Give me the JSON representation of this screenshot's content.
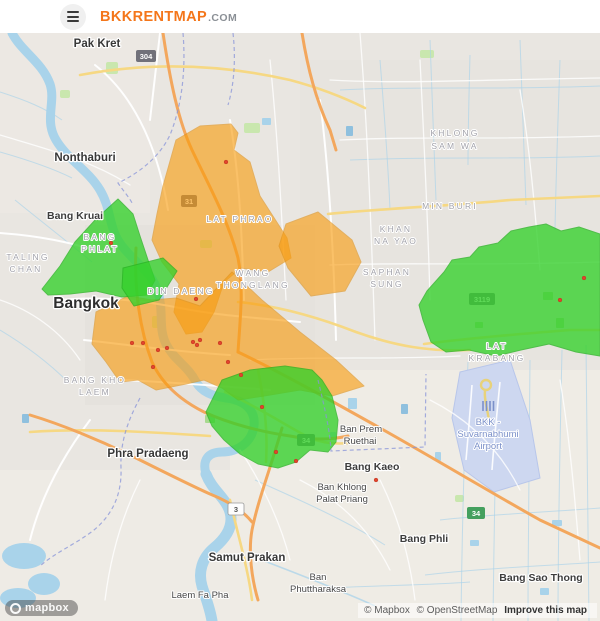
{
  "header": {
    "brand": "BKKRENTMAP",
    "brand_suffix": ".COM"
  },
  "colors": {
    "brand_orange": "#F4761A",
    "land": "#E9E6E1",
    "water": "#A9D3EA",
    "zone_orange": "#F99C0E",
    "zone_green": "#34D12B",
    "road_yellow": "#F6D883",
    "road_orange": "#F3A75D",
    "airport_fill": "#CDD7F0",
    "marker_red": "#E2442C"
  },
  "map": {
    "places": {
      "pak_kret": "Pak Kret",
      "nonthaburi": "Nonthaburi",
      "bang_kruai": "Bang Kruai",
      "bangkok": "Bangkok",
      "phra_pradaeng": "Phra Pradaeng",
      "samut_prakan": "Samut Prakan",
      "bang_kaeo": "Bang Kaeo",
      "bang_phli": "Bang Phli",
      "bang_sao_thong": "Bang Sao Thong",
      "laem_fa_pha": "Laem Fa Pha"
    },
    "villages": {
      "ban_prem_ruethai": [
        "Ban Prem",
        "Ruethai"
      ],
      "ban_khlong_palat_priang": [
        "Ban Khlong",
        "Palat Priang"
      ],
      "ban_phuttharaksa": [
        "Ban",
        "Phuttharaksa"
      ]
    },
    "districts": {
      "taling_chan": [
        "TALING",
        "CHAN"
      ],
      "bang_phlat": [
        "BANG",
        "PHLAT"
      ],
      "din_daeng": [
        "DIN DAENG"
      ],
      "lat_phrao": [
        "LAT PHRAO"
      ],
      "wang_thonglang": [
        "WANG",
        "THONGLANG"
      ],
      "khlong_sam_wa": [
        "KHLONG",
        "SAM WA"
      ],
      "min_buri": [
        "MIN BURI"
      ],
      "khan_na_yao": [
        "KHAN",
        "NA YAO"
      ],
      "saphan_sung": [
        "SAPHAN",
        "SUNG"
      ],
      "lat_krabang": [
        "LAT",
        "KRABANG"
      ],
      "bang_kho_laem": [
        "BANG KHO",
        "LAEM"
      ]
    },
    "airport_label": [
      "BKK -",
      "Suvarnabhumi",
      "Airport"
    ],
    "shields": {
      "s304": "304",
      "s31": "31",
      "s3119": "3119",
      "s34_a": "34",
      "s34_b": "34",
      "s3": "3"
    },
    "attribution": {
      "mapbox": "© Mapbox",
      "osm": "© OpenStreetMap",
      "improve": "Improve this map"
    },
    "logo": "mapbox"
  }
}
